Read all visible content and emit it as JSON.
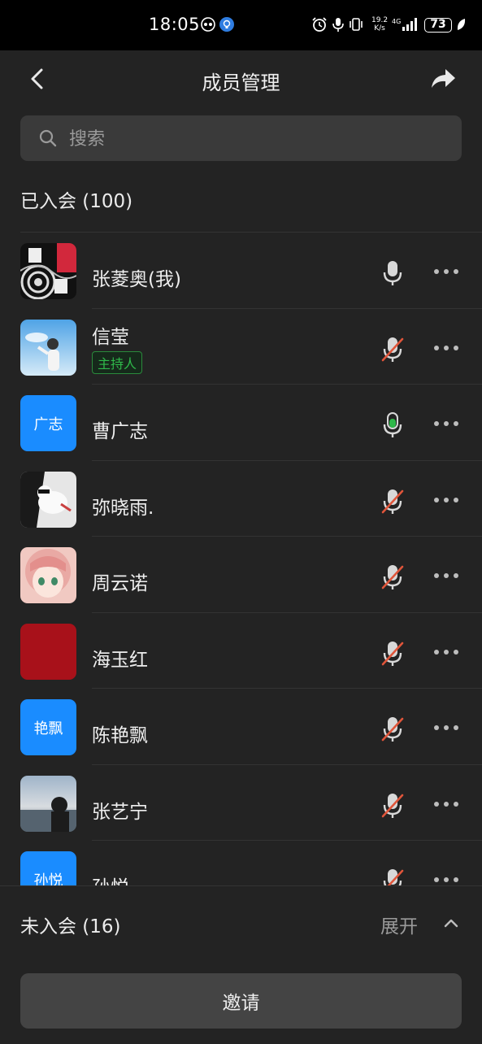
{
  "status_bar": {
    "time": "18:05",
    "net_speed_value": "19.2",
    "net_speed_unit": "K/s",
    "network": "4G",
    "battery": "73"
  },
  "header": {
    "title": "成员管理"
  },
  "search": {
    "placeholder": "搜索"
  },
  "joined": {
    "label": "已入会 (100)"
  },
  "members": [
    {
      "name": "张菱奥(我)",
      "avatar_kind": "image",
      "mic": "on"
    },
    {
      "name": "信莹",
      "avatar_kind": "image",
      "badge": "主持人",
      "mic": "muted"
    },
    {
      "name": "曹广志",
      "avatar_kind": "text",
      "avatar_text": "广志",
      "mic": "speaking"
    },
    {
      "name": "弥晓雨.",
      "avatar_kind": "image",
      "mic": "muted"
    },
    {
      "name": "周云诺",
      "avatar_kind": "image",
      "mic": "muted"
    },
    {
      "name": "海玉红",
      "avatar_kind": "image",
      "mic": "muted"
    },
    {
      "name": "陈艳飘",
      "avatar_kind": "text",
      "avatar_text": "艳飘",
      "mic": "muted"
    },
    {
      "name": "张艺宁",
      "avatar_kind": "image",
      "mic": "muted"
    },
    {
      "name": "孙悦",
      "avatar_kind": "text",
      "avatar_text": "孙悦",
      "mic": "muted"
    }
  ],
  "not_joined": {
    "label": "未入会 (16)",
    "expand_label": "展开"
  },
  "invite_label": "邀请",
  "colors": {
    "background": "#232323",
    "avatar_blue": "#1a8cff",
    "speaking_green": "#2fb84a",
    "muted_red": "#e0553a",
    "host_badge_green": "#2fb84a"
  }
}
